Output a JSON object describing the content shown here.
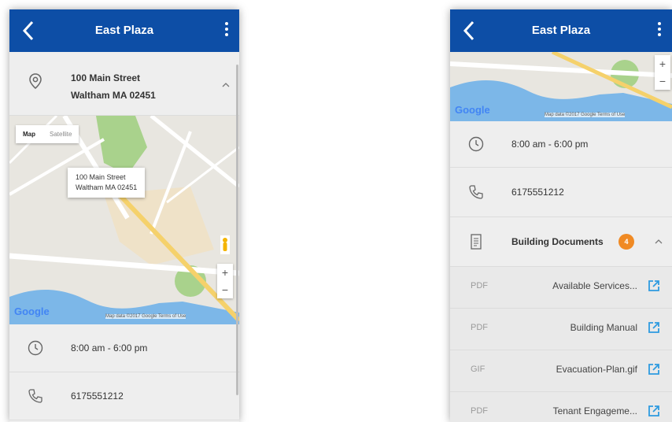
{
  "left_screen": {
    "appbar": {
      "title": "East Plaza"
    },
    "address": {
      "line1": "100 Main Street",
      "line2": "Waltham MA 02451"
    },
    "map": {
      "tab_map": "Map",
      "tab_satellite": "Satellite",
      "popup_line1": "100 Main Street",
      "popup_line2": "Waltham MA 02451",
      "zoom_in": "+",
      "zoom_out": "−",
      "google": "Google",
      "attribution": "Map data ©2017 Google  Terms of Use"
    },
    "hours": "8:00 am - 6:00 pm",
    "phone": "6175551212"
  },
  "right_screen": {
    "appbar": {
      "title": "East Plaza"
    },
    "map": {
      "zoom_in": "+",
      "zoom_out": "−",
      "google": "Google",
      "attribution": "Map data ©2017 Google  Terms of Use"
    },
    "hours": "8:00 am - 6:00 pm",
    "phone": "6175551212",
    "building_documents": {
      "label": "Building Documents",
      "count": "4"
    },
    "documents": [
      {
        "type": "PDF",
        "name": "Available Services..."
      },
      {
        "type": "PDF",
        "name": "Building Manual"
      },
      {
        "type": "GIF",
        "name": "Evacuation-Plan.gif"
      },
      {
        "type": "PDF",
        "name": "Tenant Engageme..."
      }
    ]
  },
  "colors": {
    "appbar": "#0d4ea6",
    "link": "#1f8fd6",
    "badge": "#f08a24",
    "background": "#eeeeee"
  },
  "icons": [
    "back-arrow-icon",
    "more-vert-icon",
    "location-pin-icon",
    "chevron-up-icon",
    "clock-icon",
    "phone-icon",
    "document-icon",
    "open-external-icon",
    "pegman-icon"
  ]
}
